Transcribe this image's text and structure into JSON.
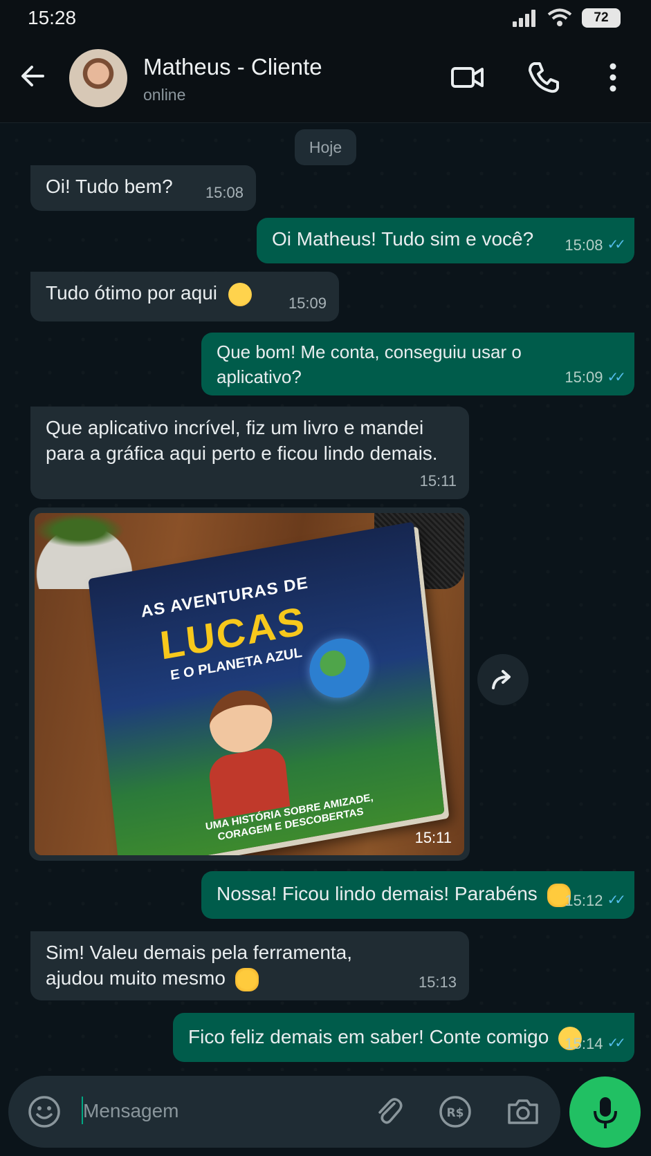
{
  "status_bar": {
    "time": "15:28",
    "battery": "72"
  },
  "header": {
    "name": "Matheus - Cliente",
    "status": "online"
  },
  "chat": {
    "date_chip": "Hoje",
    "messages": [
      {
        "dir": "in",
        "text": "Oi! Tudo bem?",
        "time": "15:08"
      },
      {
        "dir": "out",
        "text": "Oi Matheus! Tudo sim e você?",
        "time": "15:08"
      },
      {
        "dir": "in",
        "text": "Tudo ótimo por aqui",
        "time": "15:09"
      },
      {
        "dir": "out",
        "text": "Que bom! Me conta, conseguiu usar o aplicativo?",
        "time": "15:09"
      },
      {
        "dir": "in",
        "text": "Que aplicativo incrível, fiz um livro e mandei para a gráfica aqui perto e ficou lindo demais.",
        "time": "15:11"
      },
      {
        "dir": "out",
        "text": "Nossa! Ficou lindo demais! Parabéns",
        "time": "15:12"
      },
      {
        "dir": "in",
        "text": "Sim! Valeu demais pela ferramenta, ajudou muito mesmo",
        "time": "15:13"
      },
      {
        "dir": "out",
        "text": "Fico feliz demais em saber! Conte comigo",
        "time": "15:14"
      }
    ],
    "image_message": {
      "time": "15:11",
      "book_title_line1": "AS AVENTURAS DE",
      "book_title_line2": "LUCAS",
      "book_title_line3": "E O PLANETA AZUL",
      "book_subtitle": "UMA HISTÓRIA SOBRE AMIZADE, CORAGEM E DESCOBERTAS"
    }
  },
  "input": {
    "placeholder": "Mensagem"
  },
  "colors": {
    "accent": "#00a884",
    "outgoing": "#005c4b",
    "incoming": "#202c33",
    "read_ticks": "#53bdeb",
    "mic_button": "#21c063"
  }
}
